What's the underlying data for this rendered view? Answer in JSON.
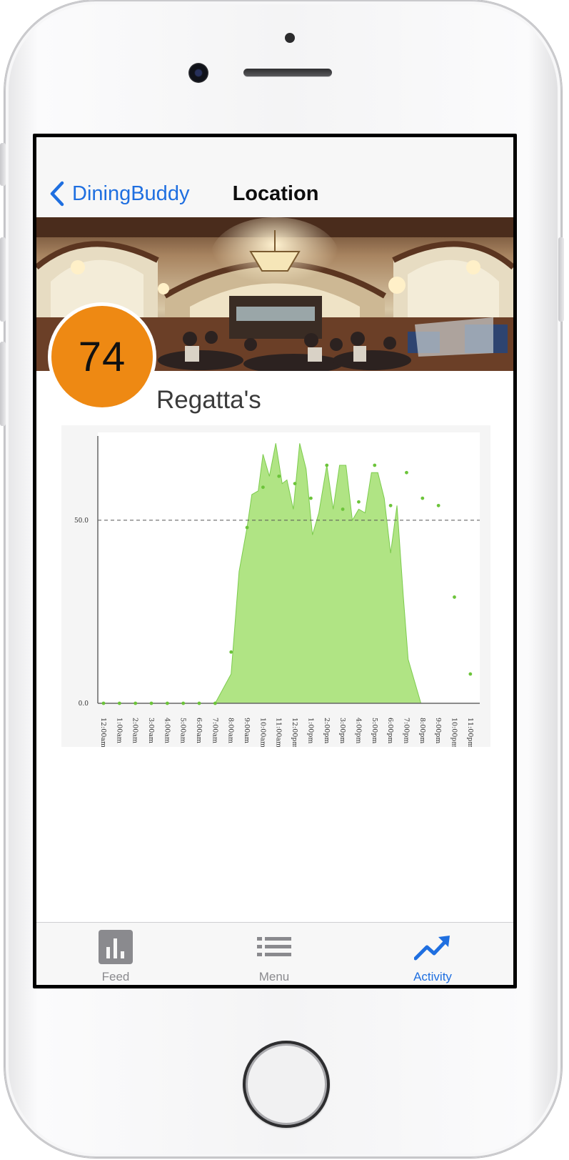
{
  "navbar": {
    "back_label": "DiningBuddy",
    "title": "Location"
  },
  "location": {
    "score": "74",
    "name": "Regatta's"
  },
  "colors": {
    "accent": "#1f6fe0",
    "score": "#ee8913",
    "fill": "#b0e484",
    "line": "#7ccb4d"
  },
  "chart_data": {
    "type": "area",
    "title": "",
    "xlabel": "",
    "ylabel": "",
    "ylim": [
      0,
      73
    ],
    "reference_line": 50.0,
    "y_ticks": [
      "0.0",
      "50.0"
    ],
    "x_ticks": [
      "12:00am",
      "1:00am",
      "2:00am",
      "3:00am",
      "4:00am",
      "5:00am",
      "6:00am",
      "7:00am",
      "8:00am",
      "9:00am",
      "10:00am",
      "11:00am",
      "12:00pm",
      "1:00pm",
      "2:00pm",
      "3:00pm",
      "4:00pm",
      "5:00pm",
      "6:00pm",
      "7:00pm",
      "8:00pm",
      "9:00pm",
      "10:00pm",
      "11:00pm"
    ],
    "x": [
      0,
      1,
      2,
      3,
      4,
      5,
      6,
      7,
      8,
      8.5,
      9,
      9.3,
      9.7,
      10,
      10.4,
      10.8,
      11.2,
      11.5,
      11.9,
      12.3,
      12.7,
      13.1,
      13.5,
      14,
      14.4,
      14.8,
      15.2,
      15.6,
      16,
      16.4,
      16.8,
      17.2,
      17.6,
      18,
      18.4,
      18.8,
      19.1,
      19.5,
      19.9,
      20.3,
      20.7,
      21.1,
      21.5,
      21.9,
      22.3,
      22.8,
      23.2
    ],
    "values": [
      0,
      0,
      0,
      0,
      0,
      0,
      0,
      0,
      8,
      36,
      48,
      57,
      58,
      68,
      62,
      71,
      60,
      61,
      53,
      71,
      64,
      46,
      52,
      65,
      53,
      65,
      65,
      50,
      53,
      52,
      63,
      63,
      56,
      41,
      54,
      29,
      12,
      6,
      0,
      0,
      0,
      0,
      0,
      0,
      0,
      0,
      0
    ],
    "marker_x": [
      0,
      1,
      2,
      3,
      4,
      5,
      6,
      7,
      8,
      9,
      10,
      11,
      12,
      13,
      14,
      15,
      16,
      17,
      18,
      19,
      20,
      21,
      22,
      23
    ],
    "marker_values": [
      0,
      0,
      0,
      0,
      0,
      0,
      0,
      0,
      14,
      48,
      59,
      62,
      60,
      56,
      65,
      53,
      55,
      65,
      54,
      63,
      56,
      54,
      29,
      8
    ]
  },
  "tabs": [
    {
      "label": "Feed",
      "icon": "bar-chart-icon"
    },
    {
      "label": "Menu",
      "icon": "list-icon"
    },
    {
      "label": "Activity",
      "icon": "trending-up-icon"
    }
  ]
}
